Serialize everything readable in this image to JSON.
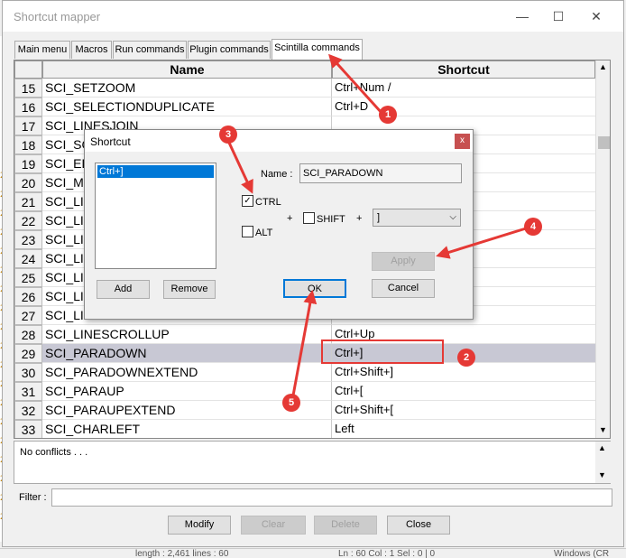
{
  "window": {
    "title": "Shortcut mapper",
    "minimize_glyph": "—",
    "maximize_glyph": "☐",
    "close_glyph": "✕"
  },
  "tabs": [
    {
      "label": "Main menu"
    },
    {
      "label": "Macros"
    },
    {
      "label": "Run commands"
    },
    {
      "label": "Plugin commands"
    },
    {
      "label": "Scintilla commands",
      "active": true
    }
  ],
  "grid": {
    "headers": [
      "Name",
      "Shortcut"
    ],
    "rows": [
      {
        "num": "15",
        "name": "SCI_SETZOOM",
        "shortcut": "Ctrl+Num /"
      },
      {
        "num": "16",
        "name": "SCI_SELECTIONDUPLICATE",
        "shortcut": "Ctrl+D"
      },
      {
        "num": "17",
        "name": "SCI_LINESJOIN",
        "shortcut": ""
      },
      {
        "num": "18",
        "name": "SCI_SCR",
        "shortcut": ""
      },
      {
        "num": "19",
        "name": "SCI_EDI",
        "shortcut": ""
      },
      {
        "num": "20",
        "name": "SCI_MO",
        "shortcut": ""
      },
      {
        "num": "21",
        "name": "SCI_LIN",
        "shortcut": ""
      },
      {
        "num": "22",
        "name": "SCI_LIN",
        "shortcut": ""
      },
      {
        "num": "23",
        "name": "SCI_LIN",
        "shortcut": ""
      },
      {
        "num": "24",
        "name": "SCI_LIN",
        "shortcut": ""
      },
      {
        "num": "25",
        "name": "SCI_LIN",
        "shortcut": ""
      },
      {
        "num": "26",
        "name": "SCI_LIN",
        "shortcut": ""
      },
      {
        "num": "27",
        "name": "SCI_LIN",
        "shortcut": ""
      },
      {
        "num": "28",
        "name": "SCI_LINESCROLLUP",
        "shortcut": "Ctrl+Up"
      },
      {
        "num": "29",
        "name": "SCI_PARADOWN",
        "shortcut": "Ctrl+]",
        "selected": true
      },
      {
        "num": "30",
        "name": "SCI_PARADOWNEXTEND",
        "shortcut": "Ctrl+Shift+]"
      },
      {
        "num": "31",
        "name": "SCI_PARAUP",
        "shortcut": "Ctrl+["
      },
      {
        "num": "32",
        "name": "SCI_PARAUPEXTEND",
        "shortcut": "Ctrl+Shift+["
      },
      {
        "num": "33",
        "name": "SCI_CHARLEFT",
        "shortcut": "Left"
      }
    ]
  },
  "conflicts": {
    "text": "No conflicts . . ."
  },
  "filter": {
    "label": "Filter :",
    "value": ""
  },
  "buttons": {
    "modify": "Modify",
    "clear": "Clear",
    "delete": "Delete",
    "close": "Close"
  },
  "dialog": {
    "title": "Shortcut",
    "close_glyph": "x",
    "list_items": [
      "Ctrl+]"
    ],
    "name_label": "Name :",
    "name_value": "SCI_PARADOWN",
    "ctrl_label": "CTRL",
    "ctrl_checked": true,
    "alt_label": "ALT",
    "alt_checked": false,
    "shift_label": "SHIFT",
    "shift_checked": false,
    "plus1": "+",
    "plus2": "+",
    "key_value": "]",
    "add": "Add",
    "remove": "Remove",
    "apply": "Apply",
    "ok": "OK",
    "cancel": "Cancel"
  },
  "annotations": {
    "badges": [
      "1",
      "2",
      "3",
      "4",
      "5"
    ],
    "color": "#e53935"
  },
  "background": {
    "left_glyphs": [
      "2",
      "2",
      "2",
      "2",
      "2",
      "2",
      "2",
      "2",
      "2",
      "2",
      "2",
      "2",
      "2",
      "2",
      "2",
      "2",
      "2",
      "2",
      "2"
    ],
    "status_fragments": [
      "length : 2,461   lines : 60",
      "Ln : 60   Col : 1   Sel : 0 | 0",
      "Windows (CR"
    ]
  },
  "colors": {
    "selection": "#c8c8d4",
    "list_selection": "#0078d7",
    "dialog_close": "#c75050"
  }
}
